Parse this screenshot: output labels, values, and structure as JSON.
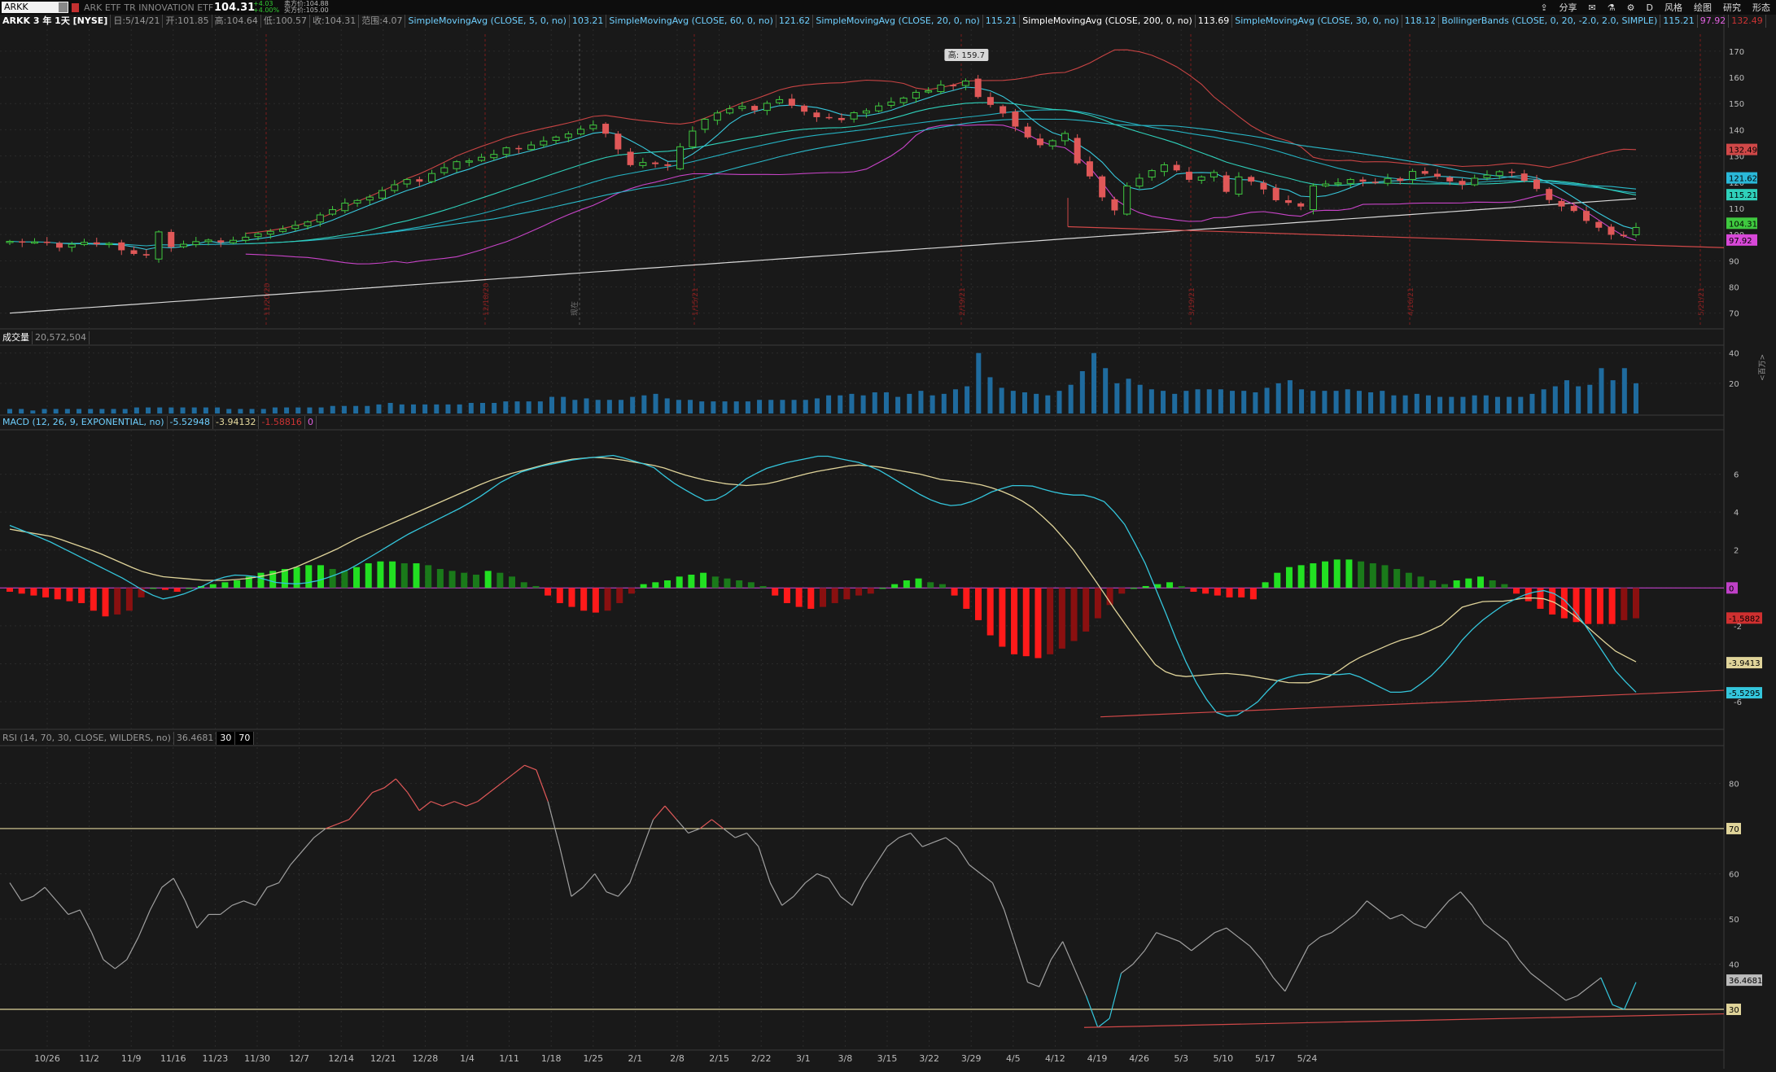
{
  "toolbar": {
    "symbol": "ARKK",
    "name": "ARK ETF TR INNOVATION ETF",
    "price": "104.31",
    "change": "+4.03",
    "change_pct": "+4.00%",
    "bid": "卖方价:104.88",
    "ask": "买方价:105.00",
    "buttons": [
      "分享",
      "D",
      "风格",
      "绘图",
      "研究",
      "形态"
    ]
  },
  "price_legend": {
    "title": "ARKK 3 年 1天 [NYSE]",
    "date": "日:5/14/21",
    "open": "开:101.85",
    "high": "高:104.64",
    "low": "低:100.57",
    "close": "收:104.31",
    "range": "范围:4.07",
    "studies": [
      {
        "label": "SimpleMovingAvg (CLOSE, 5, 0, no)",
        "value": "103.21"
      },
      {
        "label": "SimpleMovingAvg (CLOSE, 60, 0, no)",
        "value": "121.62"
      },
      {
        "label": "SimpleMovingAvg (CLOSE, 20, 0, no)",
        "value": "115.21"
      },
      {
        "label": "SimpleMovingAvg (CLOSE, 200, 0, no)",
        "value": "113.69"
      },
      {
        "label": "SimpleMovingAvg (CLOSE, 30, 0, no)",
        "value": "118.12"
      },
      {
        "label": "BollingerBands (CLOSE, 0, 20, -2.0, 2.0, SIMPLE)",
        "value": "115.21",
        "lower": "97.92",
        "upper": "132.49"
      }
    ],
    "high_marker": "高: 159.7",
    "center_label": "现在"
  },
  "volume_legend": {
    "label": "成交量",
    "value": "20,572,504",
    "unit_label": "<百万>"
  },
  "macd_legend": {
    "label": "MACD (12, 26, 9, EXPONENTIAL, no)",
    "value": "-5.52948",
    "avg": "-3.94132",
    "diff": "-1.58816",
    "zero": "0"
  },
  "rsi_legend": {
    "label": "RSI (14, 70, 30, CLOSE, WILDERS, no)",
    "value": "36.4681",
    "os": "30",
    "ob": "70"
  },
  "x_labels": [
    "10/26",
    "11/2",
    "11/9",
    "11/16",
    "11/23",
    "11/30",
    "12/7",
    "12/14",
    "12/21",
    "12/28",
    "1/4",
    "1/11",
    "1/18",
    "1/25",
    "2/1",
    "2/8",
    "2/15",
    "2/22",
    "3/1",
    "3/8",
    "3/15",
    "3/22",
    "3/29",
    "4/5",
    "4/12",
    "4/19",
    "4/26",
    "5/3",
    "5/10",
    "5/17",
    "5/24"
  ],
  "expiry_labels": [
    "11/20/20",
    "12/18/20",
    "1/15/21",
    "2/19/21",
    "3/19/21",
    "4/16/21",
    "5/21/21"
  ],
  "chart_data": [
    {
      "type": "candlestick",
      "title": "ARKK 3 年 1天 [NYSE]",
      "x_range": [
        "10/22/20",
        "5/26/21"
      ],
      "ylim": [
        64,
        174
      ],
      "y_ticks": [
        70,
        80,
        90,
        100,
        110,
        120,
        130,
        140,
        150,
        160,
        170
      ],
      "closes": [
        97.4,
        97,
        97.2,
        96.8,
        95,
        96.3,
        97,
        96.3,
        96.6,
        94,
        92.6,
        92,
        101,
        95.2,
        96.3,
        97.3,
        97.9,
        97,
        97.8,
        99,
        100.3,
        101.2,
        102.1,
        103.5,
        104.8,
        107.5,
        109.5,
        112,
        113,
        114.3,
        116.8,
        119,
        121,
        120.2,
        123.3,
        125.5,
        127.8,
        128.1,
        129.5,
        130.6,
        133.1,
        132.7,
        134.2,
        135.7,
        137.2,
        138.4,
        140.2,
        141.8,
        138.5,
        132.5,
        126.5,
        127.5,
        126.9,
        126.2,
        133.5,
        139.5,
        144,
        146.4,
        148,
        148.9,
        147.4,
        150.1,
        151.5,
        149.2,
        146.9,
        144.8,
        144.5,
        143.7,
        146.5,
        147.2,
        149.1,
        150.6,
        152.1,
        154.3,
        154.9,
        157.1,
        156.6,
        158.6,
        152.5,
        149.5,
        146.2,
        141.2,
        137.1,
        134.1,
        135.8,
        138.6,
        127.2,
        122.2,
        114.2,
        109.2,
        118.5,
        121.5,
        124.4,
        126.6,
        124.5,
        120.9,
        122,
        123.7,
        116.3,
        122,
        120.2,
        117.2,
        113.1,
        112.1,
        110.7,
        118.6,
        119.3,
        119.7,
        121,
        120.2,
        119.8,
        121.4,
        120.5,
        124.1,
        123.2,
        122.1,
        120.3,
        119,
        121.5,
        122.7,
        124,
        123.8,
        120.5,
        117.4,
        113.2,
        110.7,
        109,
        105.2,
        102.6,
        99.9,
        99.4,
        102.7
      ],
      "series": [
        {
          "name": "SimpleMovingAvg (CLOSE, 5, 0, no)",
          "last": 103.21,
          "color": "#34c6d8"
        },
        {
          "name": "SimpleMovingAvg (CLOSE, 20, 0, no)",
          "last": 115.21,
          "color": "#2fd0ba"
        },
        {
          "name": "SimpleMovingAvg (CLOSE, 30, 0, no)",
          "last": 118.12,
          "color": "#c040c8"
        },
        {
          "name": "SimpleMovingAvg (CLOSE, 60, 0, no)",
          "last": 121.62,
          "color": "#2ab8c8"
        },
        {
          "name": "SimpleMovingAvg (CLOSE, 200, 0, no)",
          "last": 113.69,
          "color": "#d8d8d8"
        },
        {
          "name": "BollingerBands Upper",
          "last": 132.49,
          "color": "#d04848"
        },
        {
          "name": "BollingerBands Lower",
          "last": 97.92,
          "color": "#d848d8"
        }
      ],
      "price_badges": [
        132.49,
        121.62,
        115.21,
        104.31,
        97.92
      ],
      "trendline": {
        "from": [
          160,
          121
        ],
        "to": [
          2115,
          94
        ],
        "color": "#d04848"
      }
    },
    {
      "type": "bar",
      "title": "成交量",
      "ylim": [
        0,
        42
      ],
      "y_ticks": [
        20,
        40
      ],
      "values": [
        3,
        3,
        2,
        3,
        3,
        3,
        3,
        3,
        3,
        3,
        3,
        4,
        4,
        4,
        4,
        4,
        4,
        4,
        4,
        3,
        3,
        3,
        3,
        4,
        4,
        4,
        4,
        4,
        5,
        5,
        5,
        5,
        6,
        7,
        6,
        6,
        6,
        6,
        6,
        6,
        7,
        7,
        7,
        8,
        8,
        8,
        8,
        11,
        11,
        9,
        10,
        9,
        9,
        9,
        11,
        12,
        13,
        10,
        9,
        9,
        8,
        8,
        8,
        8,
        8,
        9,
        9,
        9,
        9,
        9,
        10,
        12,
        12,
        13,
        12,
        14,
        14,
        11,
        13,
        15,
        12,
        13,
        16,
        18,
        40,
        24,
        17,
        15,
        14,
        13,
        12,
        15,
        19,
        28,
        40,
        30,
        20,
        23,
        19,
        16,
        15,
        13,
        15,
        16,
        16,
        16,
        15,
        15,
        14,
        17,
        20,
        22,
        16,
        15,
        15,
        15,
        16,
        15,
        14,
        15,
        12,
        12,
        13,
        12,
        11,
        11,
        11,
        12,
        12,
        11,
        11,
        11,
        13,
        16,
        18,
        22,
        18,
        19,
        30,
        22,
        30,
        20
      ]
    },
    {
      "type": "line",
      "title": "MACD (12, 26, 9, EXPONENTIAL, no)",
      "ylim": [
        -7.2,
        8
      ],
      "y_ticks": [
        -6,
        -4,
        -2,
        0,
        2,
        4,
        6
      ],
      "series": [
        {
          "name": "MACD",
          "values": [
            3.3,
            2.9,
            2.5,
            2.0,
            1.5,
            1.0,
            0.5,
            -0.1,
            -0.6,
            -0.4,
            0.0,
            0.5,
            0.7,
            0.6,
            0.3,
            0.2,
            0.3,
            0.6,
            1.0,
            1.6,
            2.2,
            2.8,
            3.3,
            3.8,
            4.3,
            4.9,
            5.6,
            6.1,
            6.4,
            6.6,
            6.8,
            6.9,
            7.0,
            6.7,
            6.4,
            5.6,
            5.0,
            4.5,
            5.0,
            5.8,
            6.3,
            6.6,
            6.8,
            7.0,
            6.8,
            6.6,
            6.2,
            5.6,
            5.0,
            4.5,
            4.3,
            4.6,
            5.1,
            5.4,
            5.4,
            5.1,
            4.9,
            4.9,
            4.5,
            3.3,
            1.4,
            -1.0,
            -3.5,
            -5.5,
            -6.8,
            -6.7,
            -6.0,
            -4.9,
            -4.6,
            -4.5,
            -4.6,
            -4.5,
            -5.0,
            -5.5,
            -5.5,
            -4.8,
            -3.8,
            -2.5,
            -1.6,
            -0.9,
            -0.4,
            -0.1,
            -0.4,
            -1.5,
            -3.0,
            -4.5,
            -5.5
          ]
        },
        {
          "name": "MACD Signal",
          "values": [
            3.1,
            2.9,
            2.7,
            2.3,
            1.9,
            1.4,
            0.9,
            0.6,
            0.5,
            0.4,
            0.4,
            0.5,
            0.7,
            1.0,
            1.5,
            2.0,
            2.6,
            3.1,
            3.6,
            4.1,
            4.6,
            5.1,
            5.6,
            6.0,
            6.3,
            6.6,
            6.8,
            6.9,
            6.8,
            6.6,
            6.4,
            6.0,
            5.7,
            5.5,
            5.4,
            5.5,
            5.8,
            6.1,
            6.3,
            6.5,
            6.4,
            6.2,
            6.0,
            5.7,
            5.6,
            5.4,
            5.0,
            4.4,
            3.4,
            2.1,
            0.5,
            -1.2,
            -2.8,
            -4.3,
            -4.7,
            -4.6,
            -4.5,
            -4.6,
            -4.8,
            -5.0,
            -5.0,
            -4.6,
            -3.8,
            -3.3,
            -2.8,
            -2.5,
            -2.0,
            -1.0,
            -0.7,
            -0.7,
            -0.5,
            -0.6,
            -1.3,
            -2.3,
            -3.3,
            -3.9
          ]
        }
      ],
      "hist_values": [
        -0.2,
        -0.3,
        -0.4,
        -0.5,
        -0.6,
        -0.7,
        -0.8,
        -1.2,
        -1.5,
        -1.4,
        -1.2,
        -0.5,
        0,
        -0.1,
        -0.2,
        0,
        0.1,
        0.2,
        0.3,
        0.4,
        0.6,
        0.8,
        0.9,
        1.0,
        1.1,
        1.2,
        1.2,
        1.0,
        0.9,
        1.1,
        1.3,
        1.4,
        1.4,
        1.3,
        1.3,
        1.2,
        1.0,
        0.9,
        0.8,
        0.7,
        0.9,
        0.8,
        0.6,
        0.3,
        0.1,
        -0.4,
        -0.8,
        -1.0,
        -1.2,
        -1.3,
        -1.2,
        -0.8,
        -0.3,
        0.2,
        0.3,
        0.4,
        0.6,
        0.7,
        0.8,
        0.6,
        0.5,
        0.4,
        0.3,
        0.1,
        -0.4,
        -0.8,
        -1.0,
        -1.1,
        -1.0,
        -0.8,
        -0.6,
        -0.4,
        -0.3,
        0,
        0.2,
        0.4,
        0.5,
        0.3,
        0.2,
        -0.4,
        -1.1,
        -1.7,
        -2.5,
        -3.1,
        -3.5,
        -3.6,
        -3.7,
        -3.5,
        -3.2,
        -2.8,
        -2.3,
        -1.6,
        -0.9,
        -0.3,
        0,
        0.1,
        0.2,
        0.3,
        0.1,
        -0.2,
        -0.3,
        -0.4,
        -0.5,
        -0.5,
        -0.6,
        0.3,
        0.8,
        1.1,
        1.2,
        1.3,
        1.4,
        1.5,
        1.5,
        1.4,
        1.3,
        1.2,
        1.0,
        0.8,
        0.6,
        0.4,
        0.2,
        0.4,
        0.5,
        0.6,
        0.4,
        0.2,
        -0.3,
        -0.7,
        -1.1,
        -1.4,
        -1.6,
        -1.8,
        -1.9,
        -1.9,
        -1.9,
        -1.7,
        -1.6
      ],
      "badges": [
        0,
        -1.5882,
        -3.9413,
        -5.5295
      ],
      "trendline": {
        "from": [
          -6.8
        ],
        "to": [
          -5.4
        ]
      }
    },
    {
      "type": "line",
      "title": "RSI (14, 70, 30, CLOSE, WILDERS, no)",
      "ylim": [
        21,
        88
      ],
      "y_ticks": [
        30,
        40,
        50,
        60,
        70,
        80
      ],
      "overbought": 70,
      "oversold": 30,
      "values": [
        58,
        54,
        55,
        57,
        54,
        51,
        52,
        47,
        41,
        39,
        41,
        46,
        52,
        57,
        59,
        54,
        48,
        51,
        51,
        53,
        54,
        53,
        57,
        58,
        62,
        65,
        68,
        70,
        71,
        72,
        75,
        78,
        79,
        81,
        78,
        74,
        76,
        75,
        76,
        75,
        76,
        78,
        80,
        82,
        84,
        83,
        76,
        66,
        55,
        57,
        60,
        56,
        55,
        58,
        65,
        72,
        75,
        72,
        69,
        70,
        72,
        70,
        68,
        69,
        66,
        58,
        53,
        55,
        58,
        60,
        59,
        55,
        53,
        58,
        62,
        66,
        68,
        69,
        66,
        67,
        68,
        66,
        62,
        60,
        58,
        52,
        44,
        36,
        35,
        41,
        45,
        39,
        33,
        26,
        28,
        38,
        40,
        43,
        47,
        46,
        45,
        43,
        45,
        47,
        48,
        46,
        44,
        41,
        37,
        34,
        39,
        44,
        46,
        47,
        49,
        51,
        54,
        52,
        50,
        51,
        49,
        48,
        51,
        54,
        56,
        53,
        49,
        47,
        45,
        41,
        38,
        36,
        34,
        32,
        33,
        35,
        37,
        31,
        30,
        36
      ]
    }
  ]
}
